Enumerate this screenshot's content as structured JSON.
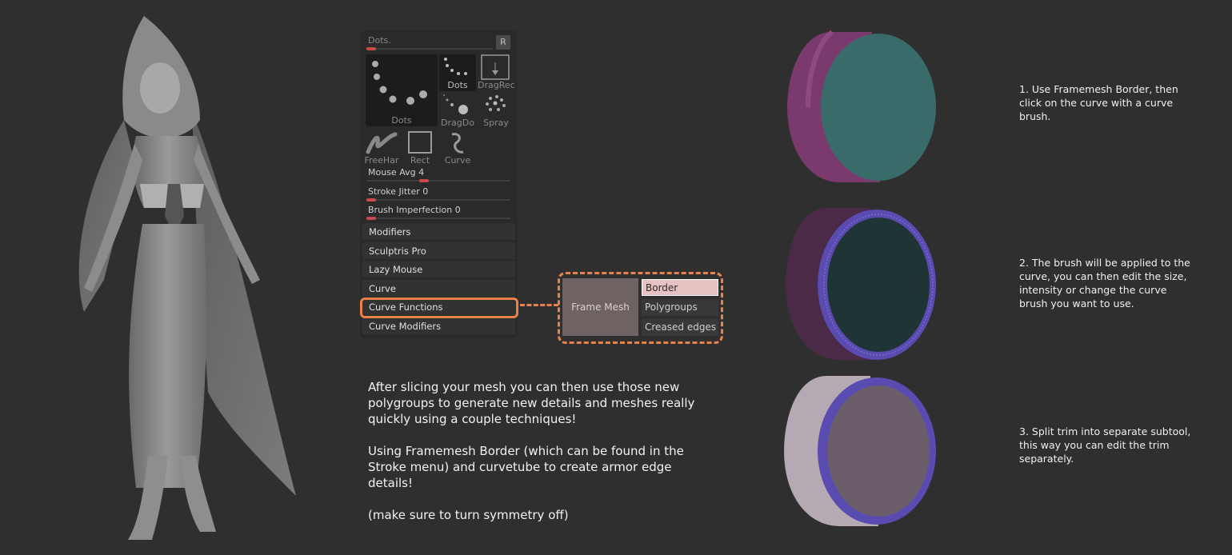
{
  "panel": {
    "dots_slider_label": "Dots.",
    "r_button": "R",
    "brushes": {
      "big": "Dots",
      "dots": "Dots",
      "dragrect": "DragRec",
      "dragdot": "DragDo",
      "spray": "Spray",
      "freehand": "FreeHar",
      "rect": "Rect",
      "curve": "Curve"
    },
    "sliders": [
      {
        "label": "Mouse Avg",
        "value": "4",
        "level": 0.4
      },
      {
        "label": "Stroke Jitter",
        "value": "0",
        "level": 0
      },
      {
        "label": "Brush Imperfection",
        "value": "0",
        "level": 0
      }
    ],
    "menu": [
      "Modifiers",
      "Sculptris Pro",
      "Lazy Mouse",
      "Curve",
      "Curve Functions",
      "Curve Modifiers"
    ]
  },
  "frame_mesh": {
    "label": "Frame Mesh",
    "options": [
      "Border",
      "Polygroups",
      "Creased edges"
    ],
    "active": "Border"
  },
  "instructions": {
    "para1": "After slicing your mesh you can then use those new polygroups to generate new details and meshes really quickly using a couple techniques!",
    "para2": "Using Framemesh Border (which can be found in the Stroke menu) and curvetube to create armor edge details!",
    "para3": "(make sure to turn symmetry off)"
  },
  "steps": [
    "1. Use Framemesh Border, then click on the curve with a curve brush.",
    "2. The brush will be applied to the curve, you can then edit the size, intensity or change the curve brush you want to use.",
    "3. Split trim into  separate subtool, this way you can edit the trim separately."
  ],
  "colors": {
    "accent": "#e8814a",
    "cylinder_magenta": "#7a3a6e",
    "cylinder_teal": "#3a6b6b",
    "trim_purple": "#5a4bb0",
    "cylinder_grey": "#b5aab3"
  }
}
